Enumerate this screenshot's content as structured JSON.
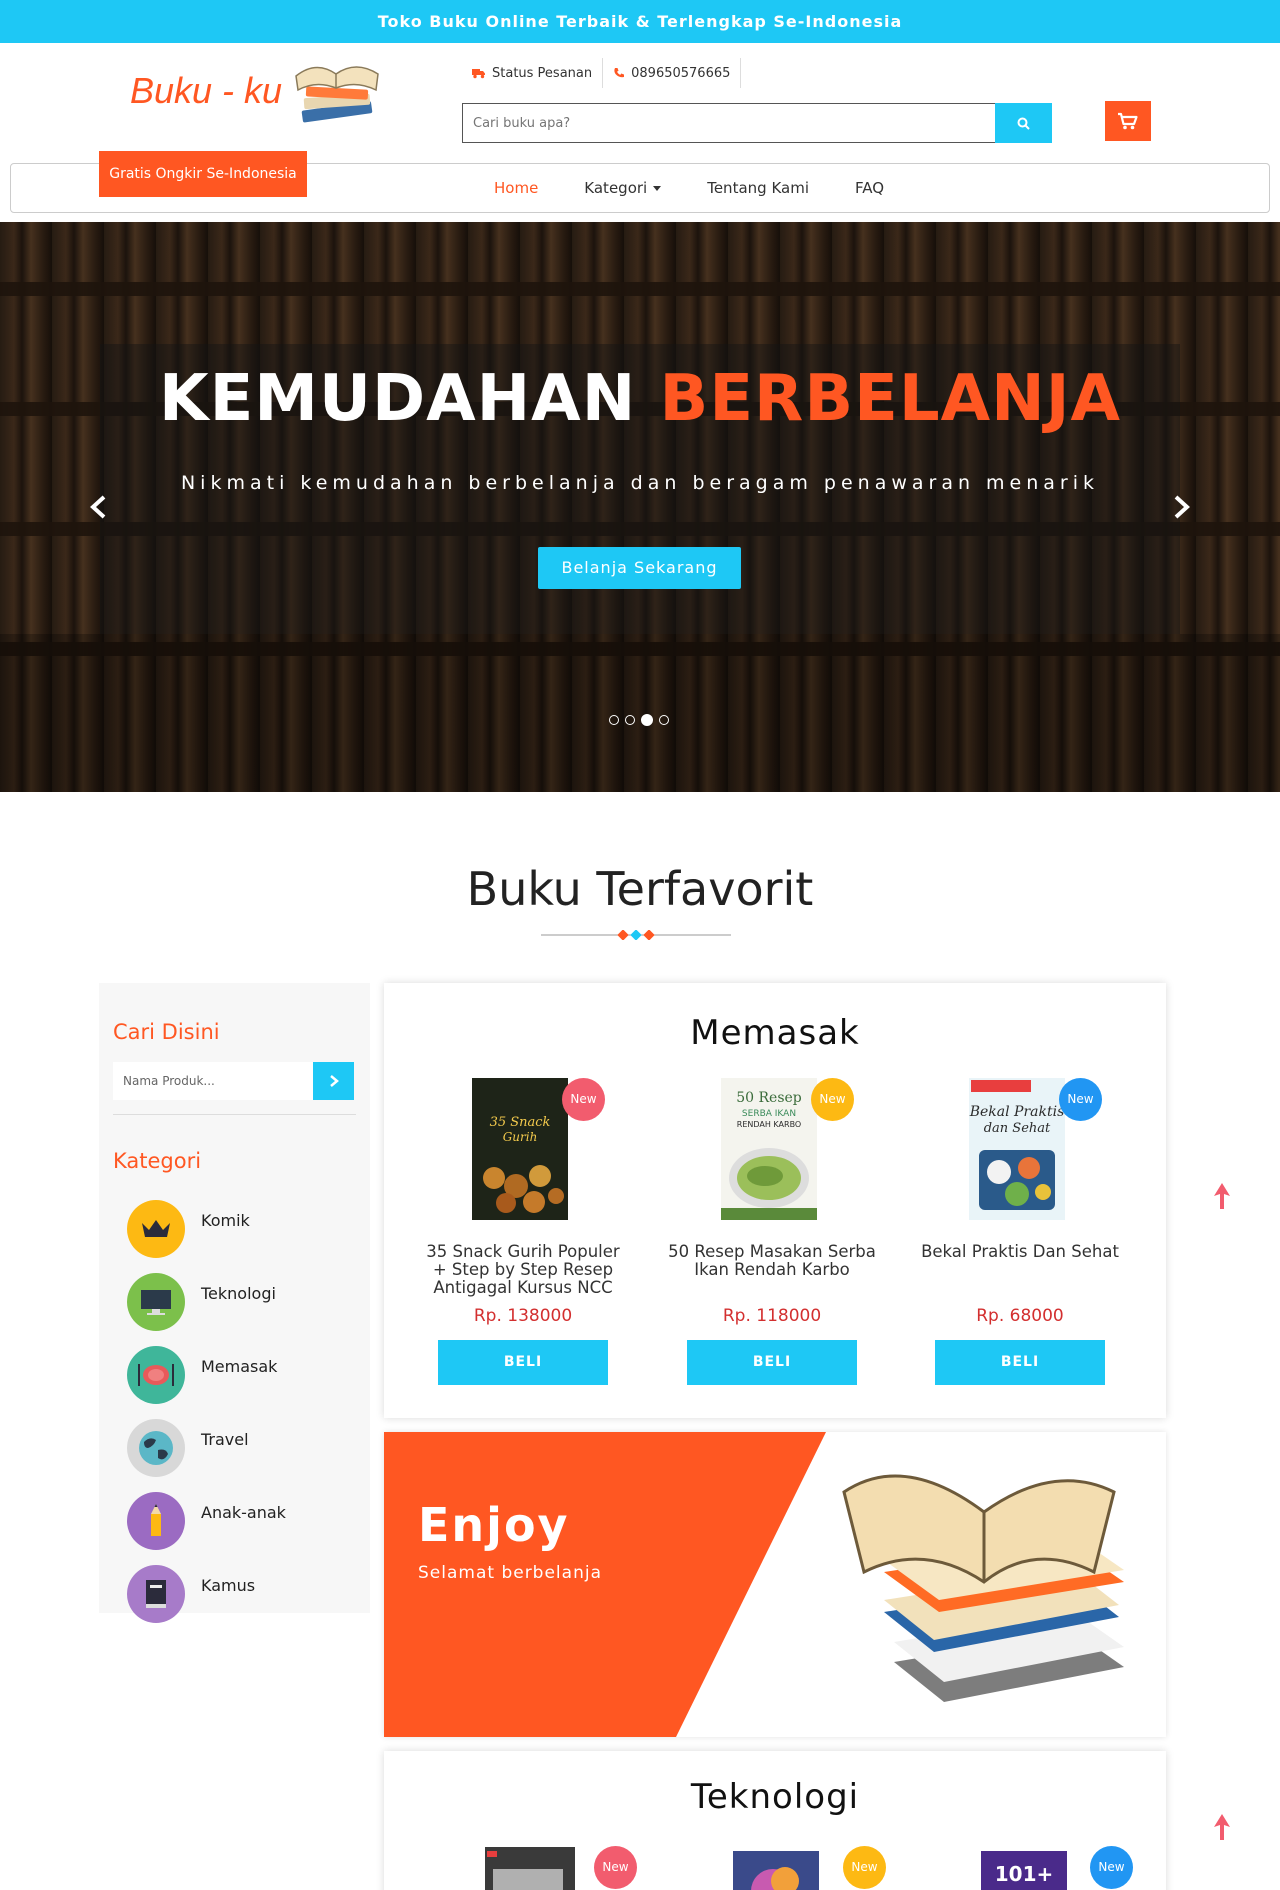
{
  "topbar": {
    "text": "Toko Buku Online Terbaik & Terlengkap Se-Indonesia"
  },
  "header": {
    "logo_text": "Buku - ku",
    "ongkir_badge": "Gratis Ongkir Se-Indonesia",
    "quick_links": [
      {
        "icon": "truck-icon",
        "label": "Status Pesanan"
      },
      {
        "icon": "phone-icon",
        "label": "089650576665"
      }
    ],
    "search_placeholder": "Cari buku apa?"
  },
  "nav": {
    "items": [
      {
        "label": "Home",
        "active": true
      },
      {
        "label": "Kategori",
        "dropdown": true
      },
      {
        "label": "Tentang Kami"
      },
      {
        "label": "FAQ"
      }
    ]
  },
  "hero": {
    "title_part1": "KEMUDAHAN",
    "title_part2": "BERBELANJA",
    "subtitle": "Nikmati kemudahan berbelanja dan beragam penawaran menarik",
    "cta": "Belanja Sekarang",
    "slides": 4,
    "active_slide": 3
  },
  "section": {
    "title": "Buku Terfavorit"
  },
  "sidebar": {
    "search_heading": "Cari Disini",
    "search_placeholder": "Nama Produk...",
    "category_heading": "Kategori",
    "categories": [
      {
        "label": "Komik",
        "icon": "crown-icon",
        "color": "#fdb913"
      },
      {
        "label": "Teknologi",
        "icon": "monitor-icon",
        "color": "#7cc04b"
      },
      {
        "label": "Memasak",
        "icon": "plate-icon",
        "color": "#3fb69a"
      },
      {
        "label": "Travel",
        "icon": "globe-icon",
        "color": "#d8d8d8"
      },
      {
        "label": "Anak-anak",
        "icon": "pencil-icon",
        "color": "#9b6bc2"
      },
      {
        "label": "Kamus",
        "icon": "book-icon",
        "color": "#a77bc9"
      }
    ]
  },
  "memasak": {
    "title": "Memasak",
    "products": [
      {
        "name": "35 Snack Gurih Populer + Step by Step Resep Antigagal Kursus NCC",
        "price": "Rp. 138000",
        "badge": "New",
        "badge_color": "#f25c6e",
        "buy": "BELI"
      },
      {
        "name": "50 Resep Masakan Serba Ikan Rendah Karbo",
        "price": "Rp. 118000",
        "badge": "New",
        "badge_color": "#fdb913",
        "buy": "BELI"
      },
      {
        "name": "Bekal Praktis Dan Sehat",
        "price": "Rp. 68000",
        "badge": "New",
        "badge_color": "#2196f3",
        "buy": "BELI"
      }
    ]
  },
  "promo": {
    "title": "Enjoy",
    "subtitle": "Selamat berbelanja"
  },
  "teknologi": {
    "title": "Teknologi",
    "badges": [
      {
        "label": "New",
        "color": "#f25c6e"
      },
      {
        "label": "New",
        "color": "#fdb913"
      },
      {
        "label": "New",
        "color": "#2196f3"
      }
    ]
  },
  "colors": {
    "accent": "#ff5722",
    "primary": "#1ec8f5"
  }
}
